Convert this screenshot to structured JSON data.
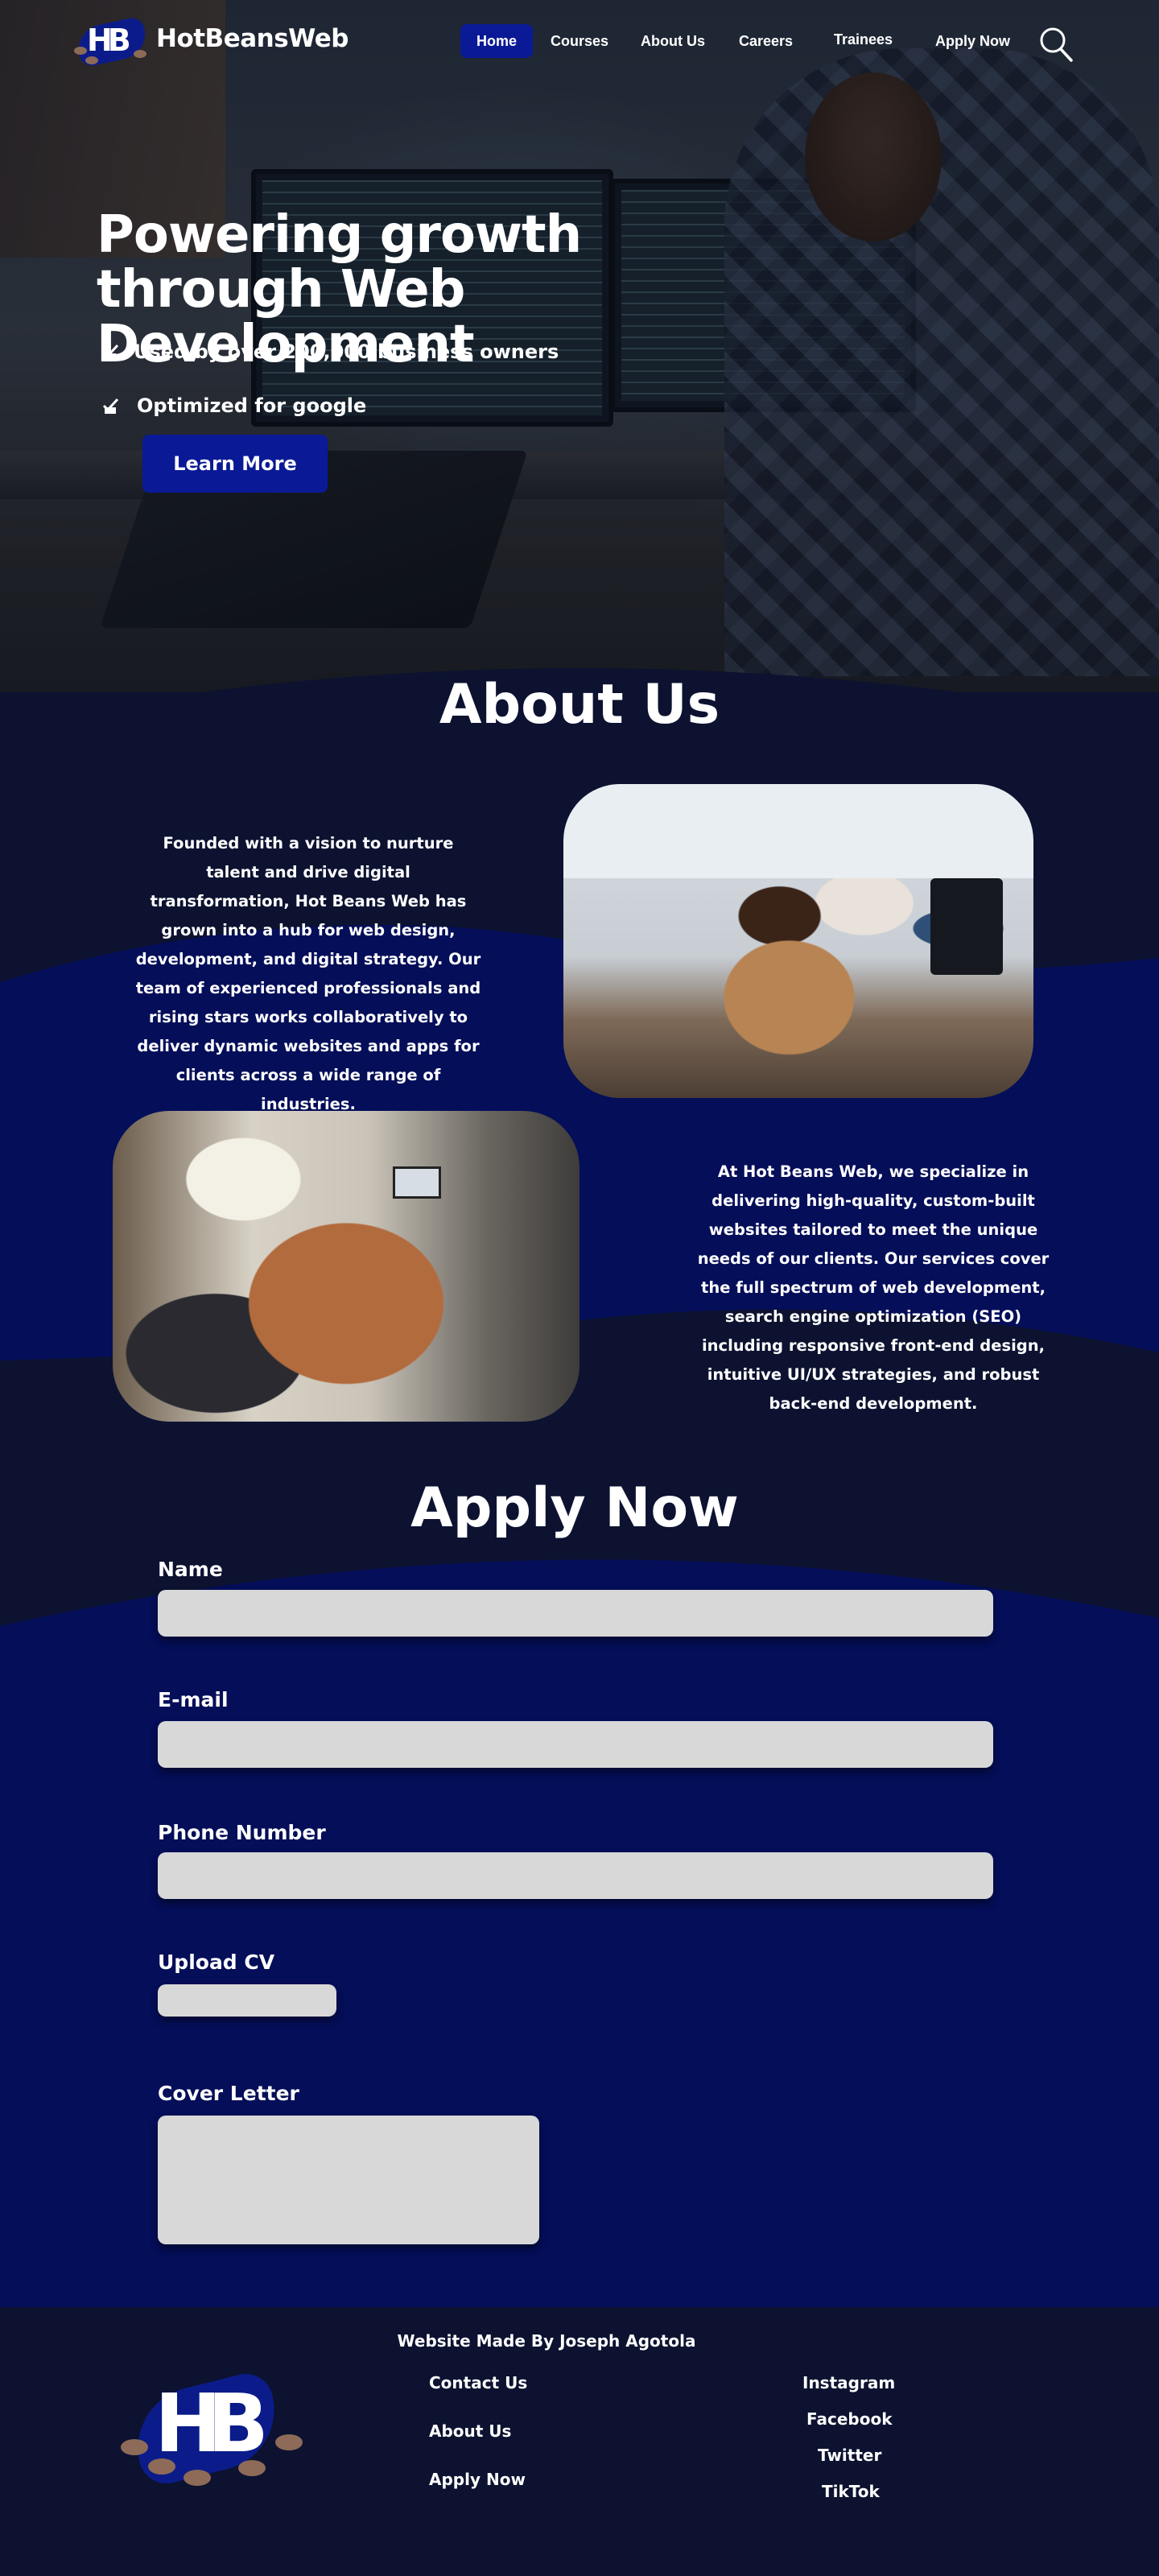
{
  "brand": {
    "logo_letters": "HB",
    "name": "HotBeansWeb"
  },
  "nav": {
    "items": [
      {
        "label": "Home",
        "active": true
      },
      {
        "label": "Courses",
        "active": false
      },
      {
        "label": "About Us",
        "active": false
      },
      {
        "label": "Careers",
        "active": false
      },
      {
        "label": "Trainees",
        "active": false
      },
      {
        "label": "Apply Now",
        "active": false
      }
    ],
    "search_icon": "search-icon"
  },
  "hero": {
    "title": "Powering growth through Web Development",
    "bullets": [
      {
        "icon": "thumbs-up-check-icon",
        "text": "Used by over 200,000 business owners"
      },
      {
        "icon": "thumbs-up-check-icon",
        "text": "Optimized for google"
      }
    ],
    "cta_label": "Learn More"
  },
  "about": {
    "title": "About Us",
    "paragraph_1": "Founded with a vision to nurture talent and drive digital transformation, Hot Beans Web has grown into a hub for web design, development, and digital strategy. Our team of experienced professionals and rising stars works collaboratively to deliver dynamic websites and apps for clients across a wide range of industries.",
    "paragraph_2": "At Hot Beans Web, we specialize in delivering high-quality, custom-built websites tailored to meet the unique needs of our clients. Our services cover the full spectrum of web development, search engine optimization (SEO) including responsive front-end design, intuitive UI/UX strategies, and robust back-end development."
  },
  "apply": {
    "title": "Apply Now",
    "fields": {
      "name": {
        "label": "Name",
        "value": "",
        "placeholder": ""
      },
      "email": {
        "label": "E-mail",
        "value": "",
        "placeholder": ""
      },
      "phone": {
        "label": "Phone Number",
        "value": "",
        "placeholder": ""
      },
      "cv": {
        "label": "Upload CV"
      },
      "cover": {
        "label": "Cover Letter",
        "value": "",
        "placeholder": ""
      }
    }
  },
  "footer": {
    "credit": "Website Made By Joseph Agotola",
    "nav_links": [
      "Contact Us",
      "About Us",
      "Apply Now"
    ],
    "social_links": [
      "Instagram",
      "Facebook",
      "Twitter",
      "TikTok"
    ]
  },
  "colors": {
    "navy_dark": "#0c1230",
    "navy_bright": "#040e59",
    "accent_button": "#0a1a96",
    "input_fill": "#d8d8d8",
    "text": "#ffffff"
  }
}
